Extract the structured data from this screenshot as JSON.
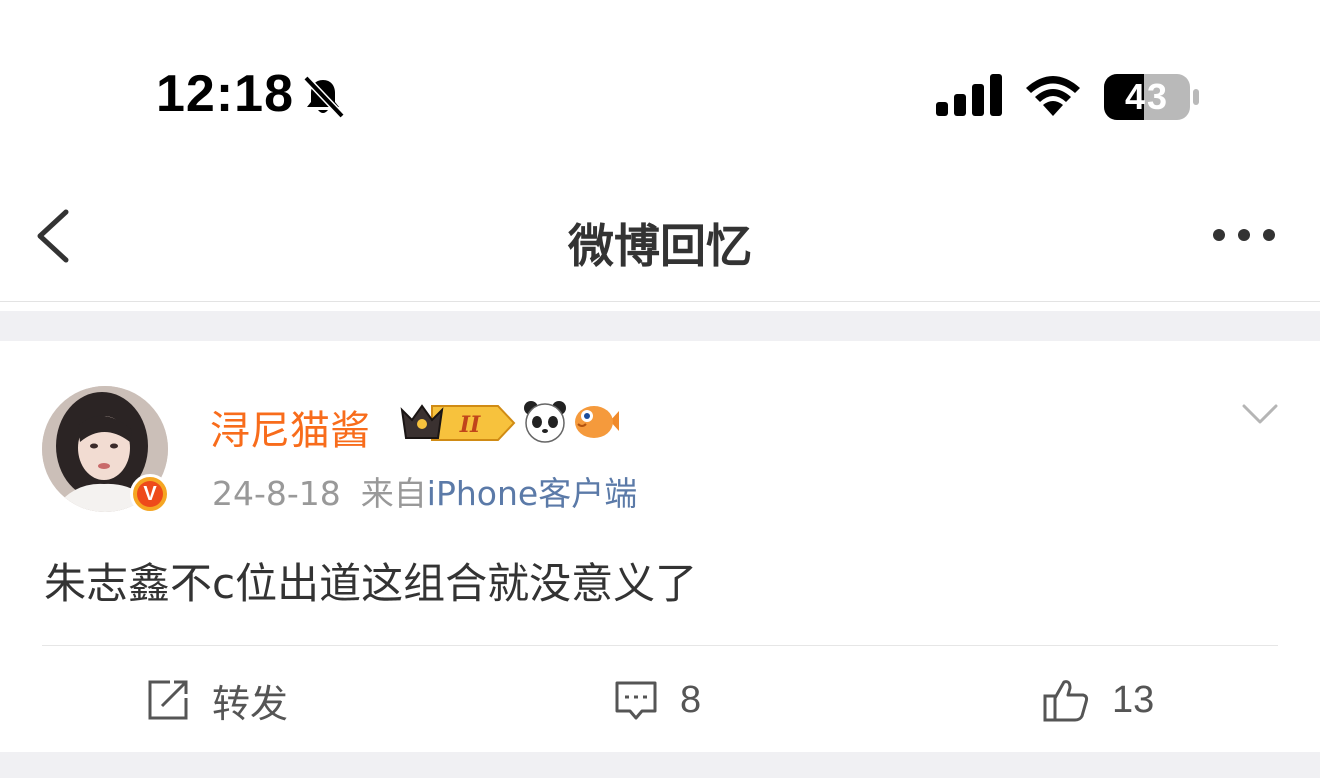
{
  "status_bar": {
    "time": "12:18",
    "battery": "43",
    "icons": [
      "bell-slash-icon",
      "cellular-signal-icon",
      "wifi-icon",
      "battery-icon"
    ]
  },
  "nav": {
    "title": "微博回忆",
    "back_icon": "chevron-left-icon",
    "more_icon": "more-dots-icon"
  },
  "post": {
    "username": "浔尼猫酱",
    "badges": [
      "crown-level-badge",
      "panda-emoji",
      "fish-emoji"
    ],
    "crown_level": "II",
    "verified_mark": "V",
    "date": "24-8-18",
    "source_prefix": "来自",
    "source": "iPhone客户端",
    "content": "朱志鑫不c位出道这组合就没意义了",
    "actions": {
      "repost_label": "转发",
      "comment_count": "8",
      "like_count": "13"
    }
  },
  "colors": {
    "username": "#f86c1b",
    "source_link": "#5b7aa8",
    "meta": "#999999",
    "background_gap": "#f0f0f3"
  }
}
